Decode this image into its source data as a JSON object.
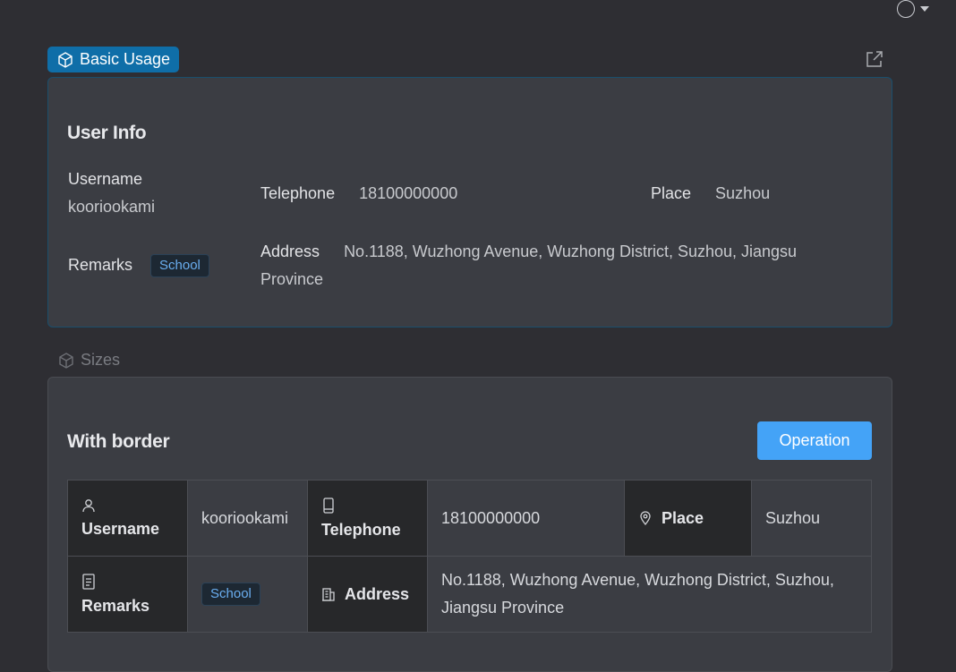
{
  "section1": {
    "label": "Basic Usage"
  },
  "section2": {
    "label": "Sizes"
  },
  "card1": {
    "title": "User Info",
    "username_label": "Username",
    "username_value": "kooriookami",
    "telephone_label": "Telephone",
    "telephone_value": "18100000000",
    "place_label": "Place",
    "place_value": "Suzhou",
    "remarks_label": "Remarks",
    "remarks_tag": "School",
    "address_label": "Address",
    "address_value": "No.1188, Wuzhong Avenue, Wuzhong District, Suzhou, Jiangsu Province"
  },
  "card2": {
    "title": "With border",
    "operation_label": "Operation",
    "username_label": "Username",
    "username_value": "kooriookami",
    "telephone_label": "Telephone",
    "telephone_value": "18100000000",
    "place_label": "Place",
    "place_value": "Suzhou",
    "remarks_label": "Remarks",
    "remarks_tag": "School",
    "address_label": "Address",
    "address_value": "No.1188, Wuzhong Avenue, Wuzhong District, Suzhou, Jiangsu Province"
  },
  "icons": {
    "theme": "circle-icon",
    "dropdown": "caret-down-icon",
    "section": "cube-icon",
    "open": "external-link-icon",
    "user": "user-icon",
    "phone": "phone-icon",
    "location": "location-icon",
    "remarks": "document-icon",
    "address": "building-icon"
  },
  "colors": {
    "accent": "#44a3f7",
    "tag_active": "#0f6ea8",
    "tag_text": "#6aaef0"
  }
}
